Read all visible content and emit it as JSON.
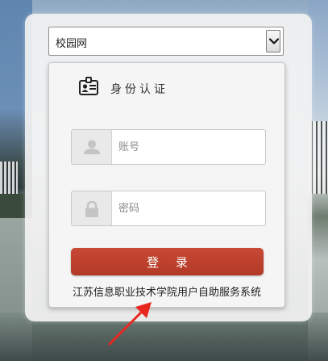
{
  "network_select": {
    "value": "校园网"
  },
  "auth_section": {
    "title": "身份认证"
  },
  "account_field": {
    "placeholder": "账号",
    "value": ""
  },
  "password_field": {
    "placeholder": "密码",
    "value": ""
  },
  "login_button": {
    "label": "登 录"
  },
  "footer": {
    "system_name": "江苏信息职业技术学院用户自助服务系统"
  },
  "colors": {
    "button": "#b93f2b",
    "annotation_arrow": "#e8281e"
  },
  "icons": {
    "select_arrow": "chevron-down-icon",
    "auth": "id-card-icon",
    "account": "user-icon",
    "password": "lock-icon",
    "annotation": "red-arrow-icon"
  }
}
